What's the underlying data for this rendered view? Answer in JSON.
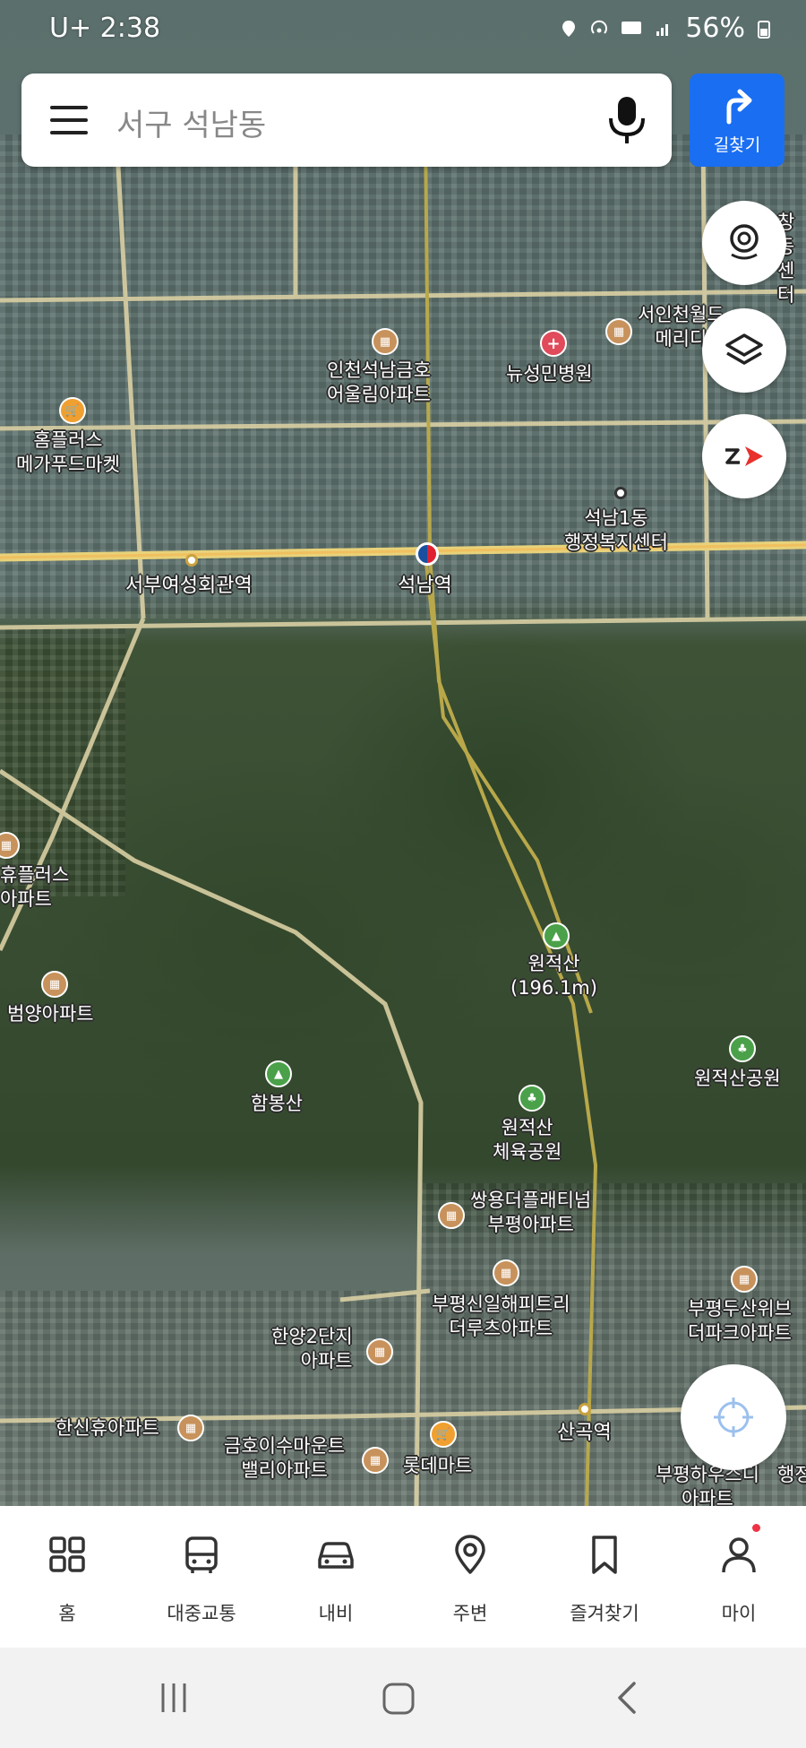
{
  "status_bar": {
    "time": "2:38",
    "carrier": "U+",
    "battery": "56%"
  },
  "search": {
    "query": "서구 석남동"
  },
  "directions_button": {
    "label": "길찾기",
    "color": "#1a6ef2"
  },
  "map": {
    "labels": {
      "apt_incheon_seoknam": "인천석남금호\n어울림아파트",
      "hospital_newseongmin": "뉴성민병원",
      "apt_seoin_meridian": "서인천월드\n메리디",
      "homeplus": "홈플러스\n메가푸드마켓",
      "seoknam1_center": "석남1동\n행정복지센터",
      "seobu_station": "서부여성회관역",
      "seoknam_station": "석남역",
      "partial_left_apt": "휴플러스\n아파트",
      "beomyang_apt": "범양아파트",
      "wonjeoksan": "원적산\n(196.1m)",
      "wonjeoksan_park": "원적산공원",
      "hambongsan": "함봉산",
      "wonjeoksan_sports_park": "원적산\n체육공원",
      "ssangyong_apt": "쌍용더플래티넘\n부평아파트",
      "bupyeong_sinil_apt": "부평신일해피트리\n더루츠아파트",
      "bupyeong_doosan_apt": "부평두산위브\n더파크아파트",
      "hanyang2_apt": "한양2단지\n아파트",
      "hansinhyu_apt": "한신휴아파트",
      "geumho_apt": "금호이수마운트\n밸리아파트",
      "lotte_mart": "롯데마트",
      "sangok_station": "산곡역",
      "bupyeong_hausdi": "부평하우스디\n아파트",
      "partial_top_right": "창동\n센터",
      "partial_right_edge": "행정"
    }
  },
  "bottom_nav": {
    "items": [
      {
        "label": "홈",
        "icon": "grid-icon"
      },
      {
        "label": "대중교통",
        "icon": "bus-icon"
      },
      {
        "label": "내비",
        "icon": "car-icon"
      },
      {
        "label": "주변",
        "icon": "location-pin-icon"
      },
      {
        "label": "즐겨찾기",
        "icon": "bookmark-icon"
      },
      {
        "label": "마이",
        "icon": "person-icon"
      }
    ]
  }
}
